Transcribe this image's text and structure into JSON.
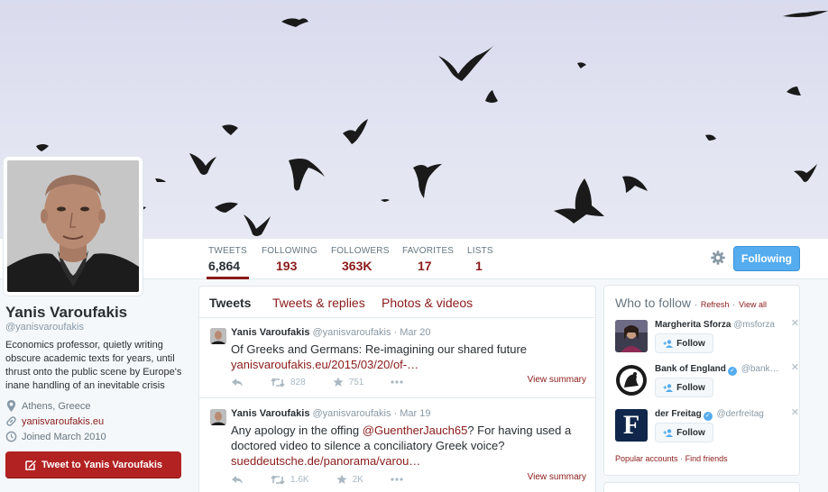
{
  "nav": {
    "stats": [
      {
        "label": "TWEETS",
        "value": "6,864"
      },
      {
        "label": "FOLLOWING",
        "value": "193"
      },
      {
        "label": "FOLLOWERS",
        "value": "363K"
      },
      {
        "label": "FAVORITES",
        "value": "17"
      },
      {
        "label": "LISTS",
        "value": "1"
      }
    ],
    "follow_button": "Following",
    "settings_icon": "gear-icon"
  },
  "profile": {
    "name": "Yanis Varoufakis",
    "handle": "@yanisvaroufakis",
    "bio": "Economics professor, quietly writing obscure academic texts for years, until thrust onto the public scene by Europe's inane handling of an inevitable crisis",
    "location": "Athens, Greece",
    "url": "yanisvaroufakis.eu",
    "joined": "Joined March 2010",
    "tweet_to_button": "Tweet to Yanis Varoufakis"
  },
  "timeline": {
    "tabs": [
      "Tweets",
      "Tweets & replies",
      "Photos & videos"
    ],
    "tweets": [
      {
        "name": "Yanis Varoufakis",
        "handle": "@yanisvaroufakis",
        "date": "· Mar 20",
        "text": "Of Greeks and Germans: Re-imagining our shared future",
        "link": "yanisvaroufakis.eu/2015/03/20/of-…",
        "retweets": "828",
        "favorites": "751",
        "view_summary": "View summary"
      },
      {
        "name": "Yanis Varoufakis",
        "handle": "@yanisvaroufakis",
        "date": "· Mar 19",
        "text_before": "Any apology in the offing ",
        "mention": "@GuentherJauch65",
        "text_after": "? For having used a doctored video to silence a conciliatory Greek voice?",
        "link": "sueddeutsche.de/panorama/varou…",
        "retweets": "1.6K",
        "favorites": "2K",
        "view_summary": "View summary"
      }
    ]
  },
  "who_to_follow": {
    "title": "Who to follow",
    "refresh": "Refresh",
    "view_all": "View all",
    "suggestions": [
      {
        "name": "Margherita Sforza",
        "handle": "@msforza",
        "verified": false,
        "button": "Follow"
      },
      {
        "name": "Bank of England",
        "handle": "@bank…",
        "verified": true,
        "button": "Follow"
      },
      {
        "name": "der Freitag",
        "handle": "@derfreitag",
        "verified": true,
        "button": "Follow"
      }
    ],
    "popular_accounts": "Popular accounts",
    "find_friends": "Find friends",
    "freitag_logo_letter": "F"
  },
  "colors": {
    "accent": "#8b1a1a",
    "follow_blue": "#55acee",
    "tweet_to_red": "#b22222"
  }
}
